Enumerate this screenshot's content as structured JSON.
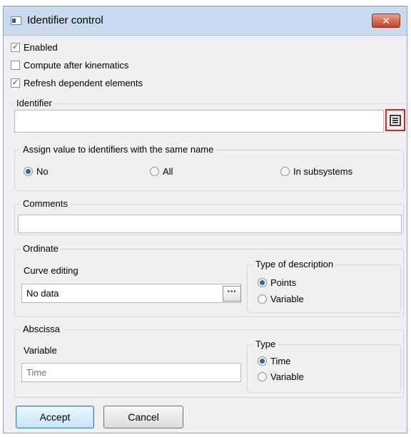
{
  "window": {
    "title": "Identifier control",
    "close_label": "✕"
  },
  "options": {
    "enabled": {
      "label": "Enabled",
      "checked": true
    },
    "compute_after_kinematics": {
      "label": "Compute after kinematics",
      "checked": false
    },
    "refresh_dependent": {
      "label": "Refresh dependent elements",
      "checked": true
    }
  },
  "identifier": {
    "legend": "Identifier",
    "value": ""
  },
  "assign": {
    "legend": "Assign value to identifiers with the same name",
    "options": [
      {
        "label": "No",
        "selected": true
      },
      {
        "label": "All",
        "selected": false
      },
      {
        "label": "In subsystems",
        "selected": false
      }
    ]
  },
  "comments": {
    "legend": "Comments",
    "value": ""
  },
  "ordinate": {
    "legend": "Ordinate",
    "curve_label": "Curve editing",
    "curve_value": "No data",
    "dots_label": "···",
    "type_legend": "Type of description",
    "type_options": [
      {
        "label": "Points",
        "selected": true
      },
      {
        "label": "Variable",
        "selected": false
      }
    ]
  },
  "abscissa": {
    "legend": "Abscissa",
    "variable_label": "Variable",
    "variable_placeholder": "Time",
    "type_legend": "Type",
    "type_options": [
      {
        "label": "Time",
        "selected": true
      },
      {
        "label": "Variable",
        "selected": false
      }
    ]
  },
  "buttons": {
    "accept": "Accept",
    "cancel": "Cancel"
  },
  "colors": {
    "highlight": "#e0202a",
    "accent": "#2a63b8"
  }
}
